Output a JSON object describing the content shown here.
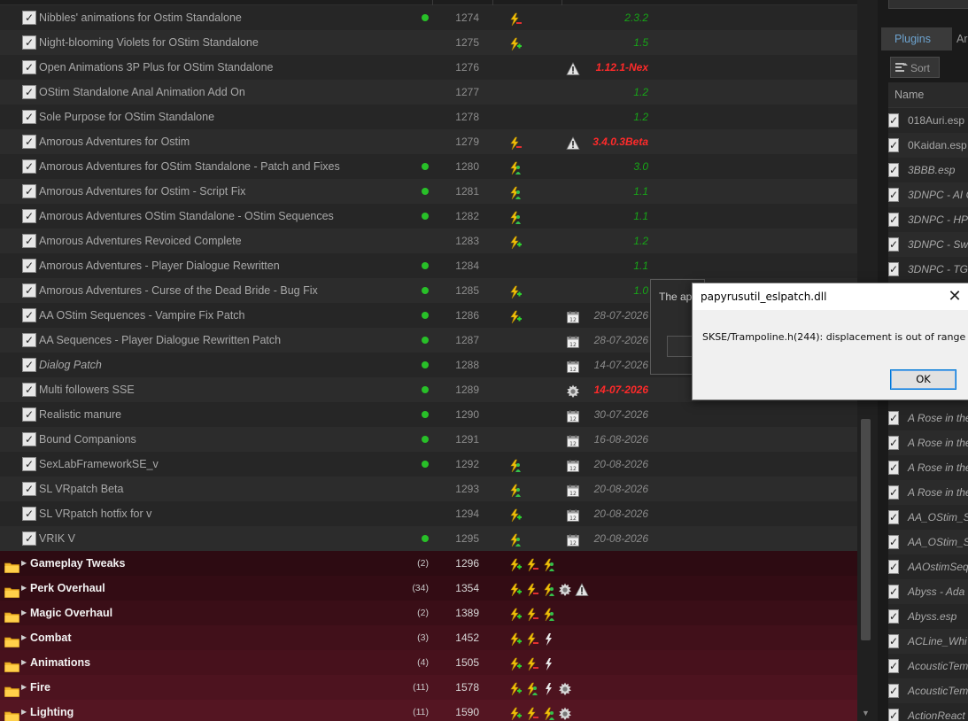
{
  "mods": [
    {
      "name": "Nibbles' animations for Ostim Standalone",
      "priority": "1274",
      "active": true,
      "flags": [
        "lightning-minus"
      ],
      "version": "2.3.2",
      "version_style": "green"
    },
    {
      "name": "Night-blooming Violets for OStim Standalone",
      "priority": "1275",
      "active": false,
      "flags": [
        "lightning-plus"
      ],
      "version": "1.5",
      "version_style": "green"
    },
    {
      "name": "Open Animations 3P Plus for OStim Standalone",
      "priority": "1276",
      "active": false,
      "flags": [],
      "marker": "warning-icon",
      "version": "1.12.1-Nex",
      "version_style": "red"
    },
    {
      "name": "OStim Standalone Anal Animation Add On",
      "priority": "1277",
      "active": false,
      "flags": [],
      "version": "1.2",
      "version_style": "green"
    },
    {
      "name": "Sole Purpose for OStim Standalone",
      "priority": "1278",
      "active": false,
      "flags": [],
      "version": "1.2",
      "version_style": "green"
    },
    {
      "name": "Amorous Adventures for Ostim",
      "priority": "1279",
      "active": false,
      "flags": [
        "lightning-minus"
      ],
      "marker": "warning-icon",
      "version": "3.4.0.3Beta",
      "version_style": "red"
    },
    {
      "name": "Amorous Adventures for OStim Standalone - Patch and Fixes",
      "priority": "1280",
      "active": true,
      "flags": [
        "lightning-person"
      ],
      "version": "3.0",
      "version_style": "green"
    },
    {
      "name": "Amorous Adventures for Ostim - Script Fix",
      "priority": "1281",
      "active": true,
      "flags": [
        "lightning-person"
      ],
      "version": "1.1",
      "version_style": "green"
    },
    {
      "name": "Amorous Adventures OStim Standalone - OStim Sequences",
      "priority": "1282",
      "active": true,
      "flags": [
        "lightning-person"
      ],
      "version": "1.1",
      "version_style": "green"
    },
    {
      "name": "Amorous Adventures Revoiced Complete",
      "priority": "1283",
      "active": false,
      "flags": [
        "lightning-plus"
      ],
      "version": "1.2",
      "version_style": "green"
    },
    {
      "name": "Amorous Adventures - Player Dialogue Rewritten",
      "priority": "1284",
      "active": true,
      "flags": [],
      "version": "1.1",
      "version_style": "green"
    },
    {
      "name": "Amorous Adventures - Curse of the Dead Bride - Bug Fix",
      "priority": "1285",
      "active": true,
      "flags": [
        "lightning-plus"
      ],
      "version": "1.0",
      "version_style": "green"
    },
    {
      "name": "AA OStim Sequences - Vampire Fix Patch",
      "priority": "1286",
      "active": true,
      "flags": [
        "lightning-plus"
      ],
      "marker": "calendar-icon",
      "version": "28-07-2026",
      "version_style": "grey"
    },
    {
      "name": "AA Sequences - Player Dialogue Rewritten Patch",
      "priority": "1287",
      "active": true,
      "flags": [],
      "marker": "calendar-icon",
      "version": "28-07-2026",
      "version_style": "grey"
    },
    {
      "name": "Dialog Patch",
      "priority": "1288",
      "active": true,
      "italic": true,
      "flags": [],
      "marker": "calendar-icon",
      "version": "14-07-2026",
      "version_style": "grey"
    },
    {
      "name": "Multi followers SSE",
      "priority": "1289",
      "active": true,
      "flags": [],
      "marker": "gear-icon",
      "version": "14-07-2026",
      "version_style": "red"
    },
    {
      "name": "Realistic manure",
      "priority": "1290",
      "active": true,
      "flags": [],
      "marker": "calendar-icon",
      "version": "30-07-2026",
      "version_style": "grey"
    },
    {
      "name": "Bound Companions",
      "priority": "1291",
      "active": true,
      "flags": [],
      "marker": "calendar-icon",
      "version": "16-08-2026",
      "version_style": "grey"
    },
    {
      "name": "SexLabFrameworkSE_v",
      "priority": "1292",
      "active": true,
      "flags": [
        "lightning-person"
      ],
      "marker": "calendar-icon",
      "version": "20-08-2026",
      "version_style": "grey"
    },
    {
      "name": "SL VRpatch Beta",
      "priority": "1293",
      "active": false,
      "flags": [
        "lightning-person"
      ],
      "marker": "calendar-icon",
      "version": "20-08-2026",
      "version_style": "grey"
    },
    {
      "name": "SL VRpatch hotfix for v",
      "priority": "1294",
      "active": false,
      "flags": [
        "lightning-plus"
      ],
      "marker": "calendar-icon",
      "version": "20-08-2026",
      "version_style": "grey"
    },
    {
      "name": "VRIK V",
      "priority": "1295",
      "active": true,
      "flags": [
        "lightning-person"
      ],
      "marker": "calendar-icon",
      "version": "20-08-2026",
      "version_style": "grey"
    }
  ],
  "separators": [
    {
      "name": "Gameplay Tweaks",
      "count": "(2)",
      "priority": "1296",
      "flags": [
        "lightning-plus",
        "lightning-minus",
        "lightning-person"
      ]
    },
    {
      "name": "Perk Overhaul",
      "count": "(34)",
      "priority": "1354",
      "flags": [
        "lightning-plus",
        "lightning-minus",
        "lightning-person",
        "gear",
        "warning"
      ]
    },
    {
      "name": "Magic Overhaul",
      "count": "(2)",
      "priority": "1389",
      "flags": [
        "lightning-plus",
        "lightning-minus",
        "lightning-person"
      ]
    },
    {
      "name": "Combat",
      "count": "(3)",
      "priority": "1452",
      "flags": [
        "lightning-plus",
        "lightning-minus",
        "lightning"
      ]
    },
    {
      "name": "Animations",
      "count": "(4)",
      "priority": "1505",
      "flags": [
        "lightning-plus",
        "lightning-minus",
        "lightning"
      ]
    },
    {
      "name": "Fire",
      "count": "(11)",
      "priority": "1578",
      "flags": [
        "lightning-plus",
        "lightning-person",
        "lightning",
        "gear"
      ]
    },
    {
      "name": "Lighting",
      "count": "(11)",
      "priority": "1590",
      "flags": [
        "lightning-plus",
        "lightning-minus",
        "lightning-person",
        "gear"
      ]
    }
  ],
  "right_panel": {
    "tab_plugins": "Plugins",
    "tab_archives": "Ar",
    "sort_label": "Sort",
    "name_header": "Name",
    "plugins_top": [
      "018Auri.esp",
      "0Kaidan.esp",
      "3BBB.esp",
      "3DNPC - AI C",
      "3DNPC - HP",
      "3DNPC - Sw",
      "3DNPC - TG"
    ],
    "plugins_bottom": [
      "A Rose in the",
      "A Rose in the",
      "A Rose in the",
      "A Rose in the",
      "AA_OStim_Se",
      "AA_OStim_Se",
      "AAOstimSeq",
      "Abyss - Ada",
      "Abyss.esp",
      "ACLine_Whi",
      "AcousticTem",
      "AcousticTem",
      "ActionReact"
    ]
  },
  "bg_dialog": {
    "text": "The ap"
  },
  "error_dialog": {
    "title": "papyrusutil_eslpatch.dll",
    "message": "SKSE/Trampoline.h(244): displacement is out of range",
    "ok_label": "OK"
  },
  "colors": {
    "active_dot": "#28c028",
    "version_green": "#17a517",
    "version_red": "#ff2a2a",
    "separator_bg": "#3b0d16"
  }
}
